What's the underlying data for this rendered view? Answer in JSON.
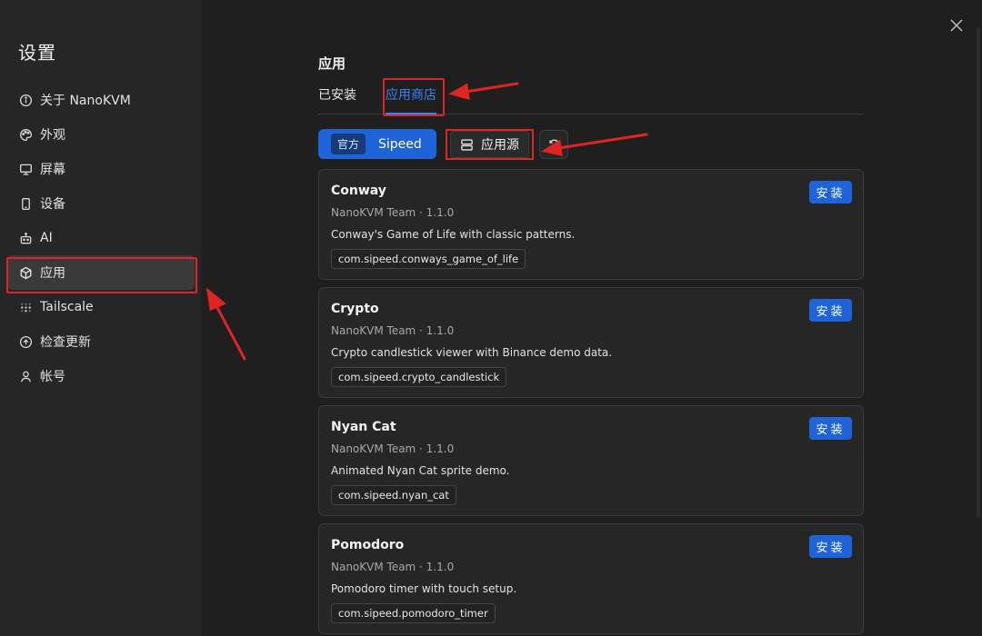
{
  "sidebar": {
    "title": "设置",
    "items": [
      {
        "label": "关于 NanoKVM",
        "icon": "info-icon"
      },
      {
        "label": "外观",
        "icon": "palette-icon"
      },
      {
        "label": "屏幕",
        "icon": "monitor-icon"
      },
      {
        "label": "设备",
        "icon": "device-icon"
      },
      {
        "label": "AI",
        "icon": "bot-icon"
      },
      {
        "label": "应用",
        "icon": "package-icon",
        "active": true
      },
      {
        "label": "Tailscale",
        "icon": "dots-grid-icon"
      },
      {
        "label": "检查更新",
        "icon": "arrow-up-circle-icon"
      },
      {
        "label": "帐号",
        "icon": "user-icon"
      }
    ]
  },
  "main": {
    "title": "应用",
    "tabs": [
      {
        "label": "已安装"
      },
      {
        "label": "应用商店",
        "active": true
      }
    ],
    "source": {
      "badge": "官方",
      "label": "Sipeed"
    },
    "app_source_button": "应用源",
    "apps": [
      {
        "name": "Conway",
        "meta": "NanoKVM Team · 1.1.0",
        "description": "Conway's Game of Life with classic patterns.",
        "package": "com.sipeed.conways_game_of_life",
        "install": "安装"
      },
      {
        "name": "Crypto",
        "meta": "NanoKVM Team · 1.1.0",
        "description": "Crypto candlestick viewer with Binance demo data.",
        "package": "com.sipeed.crypto_candlestick",
        "install": "安装"
      },
      {
        "name": "Nyan Cat",
        "meta": "NanoKVM Team · 1.1.0",
        "description": "Animated Nyan Cat sprite demo.",
        "package": "com.sipeed.nyan_cat",
        "install": "安装"
      },
      {
        "name": "Pomodoro",
        "meta": "NanoKVM Team · 1.1.0",
        "description": "Pomodoro timer with touch setup.",
        "package": "com.sipeed.pomodoro_timer",
        "install": "安装"
      }
    ]
  },
  "colors": {
    "accent": "#1e64d8",
    "annotation": "#e02424",
    "tab_active": "#3b82f6"
  }
}
